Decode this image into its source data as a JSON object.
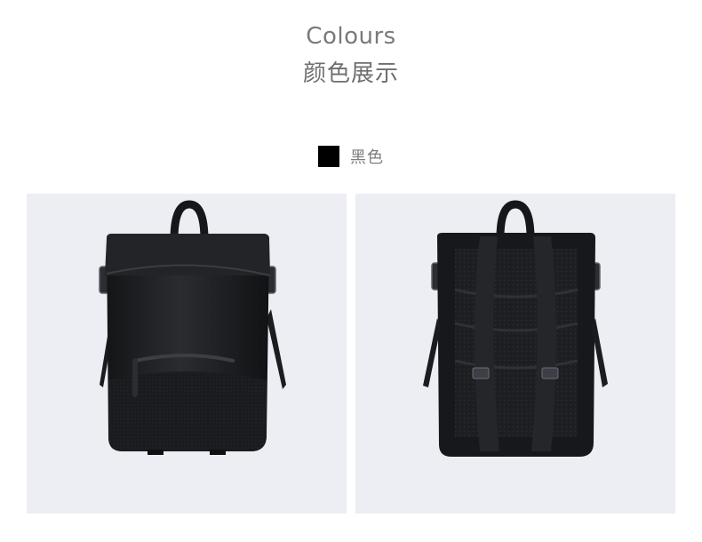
{
  "header": {
    "title_en": "Colours",
    "title_cn": "颜色展示"
  },
  "swatch": {
    "label": "黑色",
    "color": "#000000"
  },
  "colors": {
    "background": "#ffffff",
    "photo_bg": "#eceef3",
    "bag": "#1d1e21"
  },
  "photos": [
    {
      "view": "front",
      "icon": "backpack-front"
    },
    {
      "view": "back",
      "icon": "backpack-back"
    }
  ]
}
